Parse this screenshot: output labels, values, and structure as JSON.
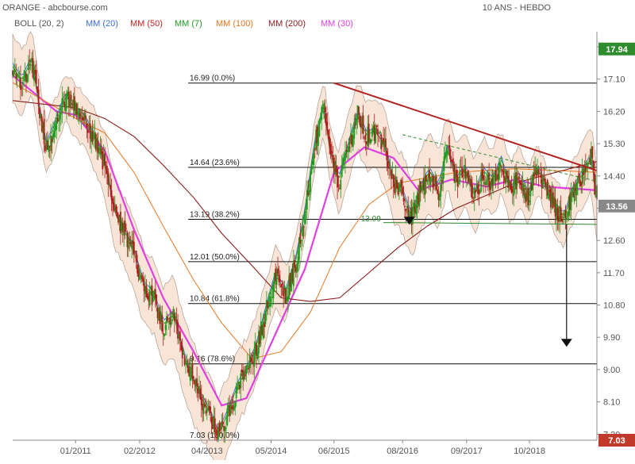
{
  "header": {
    "title": "ORANGE - abcbourse.com",
    "period": "10 ANS - HEBDO"
  },
  "legend": [
    {
      "label": "BOLL (20, 2)",
      "color": "#555555"
    },
    {
      "label": "MM (20)",
      "color": "#3b6fd6"
    },
    {
      "label": "MM (50)",
      "color": "#cc2222"
    },
    {
      "label": "MM (7)",
      "color": "#1f9a1f"
    },
    {
      "label": "MM (100)",
      "color": "#e87722"
    },
    {
      "label": "MM (200)",
      "color": "#8b1a1a"
    },
    {
      "label": "MM (30)",
      "color": "#e040e0"
    }
  ],
  "chart_data": {
    "type": "candlestick",
    "y_axis": {
      "range": [
        7.03,
        18.2
      ],
      "ticks": [
        "7.20",
        "8.10",
        "9.00",
        "9.90",
        "10.80",
        "11.70",
        "12.60",
        "13.50",
        "14.40",
        "15.30",
        "16.20",
        "17.10",
        "18.00"
      ],
      "ticks_values": [
        7.2,
        8.1,
        9.0,
        9.9,
        10.8,
        11.7,
        12.6,
        13.5,
        14.4,
        15.3,
        16.2,
        17.1,
        18.0
      ]
    },
    "x_axis": {
      "labels": [
        "01/2011",
        "02/2012",
        "04/2013",
        "05/2014",
        "06/2015",
        "08/2016",
        "09/2017",
        "10/2018"
      ],
      "dates": [
        "2011-01-03",
        "2012-02-06",
        "2013-04-01",
        "2014-05-05",
        "2015-06-01",
        "2016-08-01",
        "2017-09-04",
        "2018-10-01"
      ],
      "range": [
        "2009-12-07",
        "2019-11-25"
      ]
    },
    "price_flags": [
      {
        "value": "17.94",
        "color": "#2e8b2e"
      },
      {
        "value": "13.56",
        "color": "#888888"
      },
      {
        "value": "7.03",
        "color": "#c0392b"
      }
    ],
    "fibonacci": {
      "high": 16.99,
      "low": 7.03,
      "levels": [
        {
          "label": "16.99 (0.0%)",
          "value": 16.99
        },
        {
          "label": "14.64 (23.6%)",
          "value": 14.64
        },
        {
          "label": "13.19 (38.2%)",
          "value": 13.19
        },
        {
          "label": "12.01 (50.0%)",
          "value": 12.01
        },
        {
          "label": "10.84 (61.8%)",
          "value": 10.84
        },
        {
          "label": "9.16 (78.6%)",
          "value": 9.16
        },
        {
          "label": "7.03 (100.0%)",
          "value": 7.03
        }
      ]
    },
    "annotations": {
      "support_label": "13.09",
      "support_value": 13.09,
      "target_value": 9.7
    },
    "price_path": [
      [
        "2009-12-07",
        17.4
      ],
      [
        "2010-02-01",
        17.0
      ],
      [
        "2010-04-05",
        17.6
      ],
      [
        "2010-05-24",
        16.2
      ],
      [
        "2010-07-05",
        15.2
      ],
      [
        "2010-09-06",
        15.9
      ],
      [
        "2010-11-01",
        16.6
      ],
      [
        "2011-01-03",
        16.2
      ],
      [
        "2011-03-07",
        15.9
      ],
      [
        "2011-05-02",
        15.4
      ],
      [
        "2011-07-04",
        14.7
      ],
      [
        "2011-09-05",
        13.3
      ],
      [
        "2011-11-07",
        12.8
      ],
      [
        "2012-01-02",
        12.2
      ],
      [
        "2012-03-05",
        11.3
      ],
      [
        "2012-05-07",
        11.0
      ],
      [
        "2012-07-02",
        10.2
      ],
      [
        "2012-09-03",
        10.5
      ],
      [
        "2012-11-05",
        9.4
      ],
      [
        "2013-01-07",
        8.6
      ],
      [
        "2013-03-04",
        8.1
      ],
      [
        "2013-05-06",
        7.6
      ],
      [
        "2013-06-03",
        7.1
      ],
      [
        "2013-08-05",
        7.7
      ],
      [
        "2013-10-07",
        8.5
      ],
      [
        "2013-12-02",
        8.9
      ],
      [
        "2014-02-03",
        9.6
      ],
      [
        "2014-04-07",
        10.7
      ],
      [
        "2014-06-02",
        11.6
      ],
      [
        "2014-08-04",
        11.1
      ],
      [
        "2014-10-06",
        12.0
      ],
      [
        "2014-12-01",
        13.3
      ],
      [
        "2015-02-02",
        15.3
      ],
      [
        "2015-03-30",
        16.3
      ],
      [
        "2015-05-04",
        15.1
      ],
      [
        "2015-06-29",
        14.2
      ],
      [
        "2015-08-31",
        15.2
      ],
      [
        "2015-10-26",
        16.1
      ],
      [
        "2015-12-21",
        15.5
      ],
      [
        "2016-02-15",
        15.6
      ],
      [
        "2016-04-11",
        15.2
      ],
      [
        "2016-06-06",
        14.2
      ],
      [
        "2016-08-01",
        13.9
      ],
      [
        "2016-09-26",
        13.2
      ],
      [
        "2016-11-21",
        14.0
      ],
      [
        "2017-01-16",
        14.5
      ],
      [
        "2017-03-13",
        14.0
      ],
      [
        "2017-05-08",
        15.1
      ],
      [
        "2017-07-03",
        14.2
      ],
      [
        "2017-08-28",
        14.6
      ],
      [
        "2017-10-23",
        13.8
      ],
      [
        "2017-12-18",
        14.5
      ],
      [
        "2018-02-12",
        14.2
      ],
      [
        "2018-04-09",
        14.8
      ],
      [
        "2018-06-04",
        13.9
      ],
      [
        "2018-07-30",
        14.4
      ],
      [
        "2018-09-24",
        13.8
      ],
      [
        "2018-11-19",
        14.6
      ],
      [
        "2019-01-14",
        14.0
      ],
      [
        "2019-03-11",
        13.5
      ],
      [
        "2019-05-06",
        13.2
      ],
      [
        "2019-07-01",
        14.0
      ],
      [
        "2019-08-26",
        14.4
      ],
      [
        "2019-10-21",
        14.9
      ],
      [
        "2019-11-25",
        13.56
      ]
    ],
    "moving_averages": {
      "mm30": [
        [
          "2009-12-07",
          17.2
        ],
        [
          "2010-09-06",
          16.2
        ],
        [
          "2011-01-03",
          16.1
        ],
        [
          "2011-07-04",
          15.1
        ],
        [
          "2012-01-02",
          12.9
        ],
        [
          "2012-07-02",
          11.0
        ],
        [
          "2013-01-07",
          9.5
        ],
        [
          "2013-07-01",
          8.0
        ],
        [
          "2013-12-02",
          8.2
        ],
        [
          "2014-06-02",
          10.0
        ],
        [
          "2014-12-01",
          11.8
        ],
        [
          "2015-06-01",
          14.5
        ],
        [
          "2015-12-07",
          15.2
        ],
        [
          "2016-06-06",
          14.9
        ],
        [
          "2016-11-07",
          14.0
        ],
        [
          "2017-06-05",
          14.3
        ],
        [
          "2018-01-08",
          14.1
        ],
        [
          "2018-07-02",
          14.3
        ],
        [
          "2019-01-07",
          14.1
        ],
        [
          "2019-11-25",
          14.0
        ]
      ],
      "mm100": [
        [
          "2009-12-07",
          17.0
        ],
        [
          "2011-01-03",
          16.0
        ],
        [
          "2011-07-04",
          15.6
        ],
        [
          "2012-01-02",
          14.5
        ],
        [
          "2012-07-02",
          13.0
        ],
        [
          "2013-01-07",
          11.5
        ],
        [
          "2013-07-01",
          10.3
        ],
        [
          "2014-01-06",
          9.3
        ],
        [
          "2014-07-07",
          9.5
        ],
        [
          "2015-01-05",
          10.6
        ],
        [
          "2015-07-06",
          12.4
        ],
        [
          "2016-01-04",
          13.6
        ],
        [
          "2016-07-04",
          14.2
        ],
        [
          "2017-07-03",
          14.5
        ],
        [
          "2018-07-02",
          14.6
        ],
        [
          "2019-11-25",
          14.5
        ]
      ],
      "mm200": [
        [
          "2009-12-07",
          16.5
        ],
        [
          "2011-01-03",
          16.3
        ],
        [
          "2011-07-04",
          16.0
        ],
        [
          "2012-01-02",
          15.5
        ],
        [
          "2012-07-02",
          14.7
        ],
        [
          "2013-01-07",
          13.8
        ],
        [
          "2013-07-01",
          12.8
        ],
        [
          "2014-01-06",
          11.9
        ],
        [
          "2014-07-07",
          11.0
        ],
        [
          "2015-01-05",
          10.9
        ],
        [
          "2015-07-06",
          11.0
        ],
        [
          "2016-01-04",
          11.7
        ],
        [
          "2016-07-04",
          12.4
        ],
        [
          "2017-01-02",
          13.0
        ],
        [
          "2017-07-03",
          13.5
        ],
        [
          "2018-07-02",
          14.2
        ],
        [
          "2019-11-25",
          14.8
        ]
      ]
    },
    "trendlines": [
      {
        "from": [
          "2015-06-01",
          16.99
        ],
        "to": [
          "2019-11-25",
          14.55
        ],
        "color": "#b22222"
      },
      {
        "from": [
          "2016-08-01",
          15.55
        ],
        "to": [
          "2019-11-25",
          14.25
        ],
        "color": "#2e8b2e",
        "dashed": true
      },
      {
        "from": [
          "2016-04-04",
          13.1
        ],
        "to": [
          "2019-11-25",
          13.05
        ],
        "color": "#2e8b2e"
      }
    ]
  }
}
